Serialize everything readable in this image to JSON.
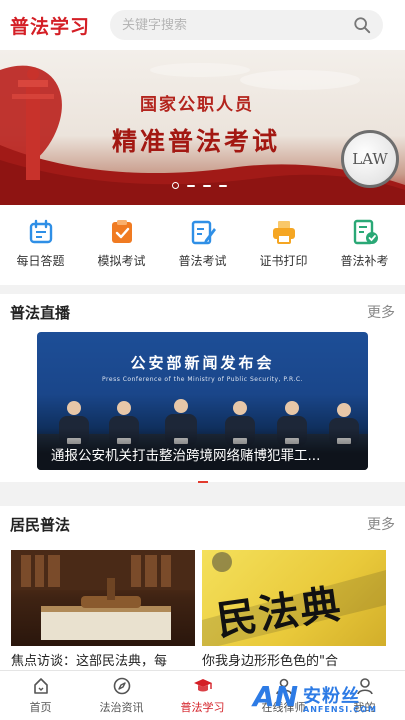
{
  "header": {
    "title": "普法学习",
    "search_placeholder": "关键字搜索"
  },
  "banner": {
    "line1": "国家公职人员",
    "line2": "精准普法考试",
    "badge": "LAW",
    "slide_count": 4,
    "active_slide": 1
  },
  "quick_menu": [
    {
      "label": "每日答题",
      "icon": "calendar-icon",
      "color": "#2f8fe6"
    },
    {
      "label": "模拟考试",
      "icon": "checklist-icon",
      "color": "#f07b22"
    },
    {
      "label": "普法考试",
      "icon": "edit-doc-icon",
      "color": "#2f8fe6"
    },
    {
      "label": "证书打印",
      "icon": "printer-icon",
      "color": "#f5a623"
    },
    {
      "label": "普法补考",
      "icon": "retest-doc-icon",
      "color": "#2aa876"
    }
  ],
  "live": {
    "title": "普法直播",
    "more": "更多",
    "card_heading": "公安部新闻发布会",
    "card_subheading": "Press Conference of the Ministry of Public Security, P.R.C.",
    "card_caption": "通报公安机关打击整治跨境网络赌博犯罪工..."
  },
  "residents": {
    "title": "居民普法",
    "more": "更多",
    "cards": [
      {
        "caption": "焦点访谈：这部民法典，每"
      },
      {
        "caption": "你我身边形形色色的\"合",
        "image_text": "民法典"
      }
    ]
  },
  "tabbar": {
    "tabs": [
      {
        "label": "首页",
        "icon": "home-icon"
      },
      {
        "label": "法治资讯",
        "icon": "compass-icon"
      },
      {
        "label": "普法学习",
        "icon": "graduation-cap-icon",
        "active": true
      },
      {
        "label": "在线律师",
        "icon": "lawyer-icon"
      },
      {
        "label": "我的",
        "icon": "profile-icon"
      }
    ]
  },
  "watermark": {
    "logo": "AN",
    "brand_cn": "安粉丝",
    "brand_en": "ANFENSI.COM"
  },
  "colors": {
    "brand_red": "#d41f26",
    "accent_blue": "#2f8fe6"
  }
}
